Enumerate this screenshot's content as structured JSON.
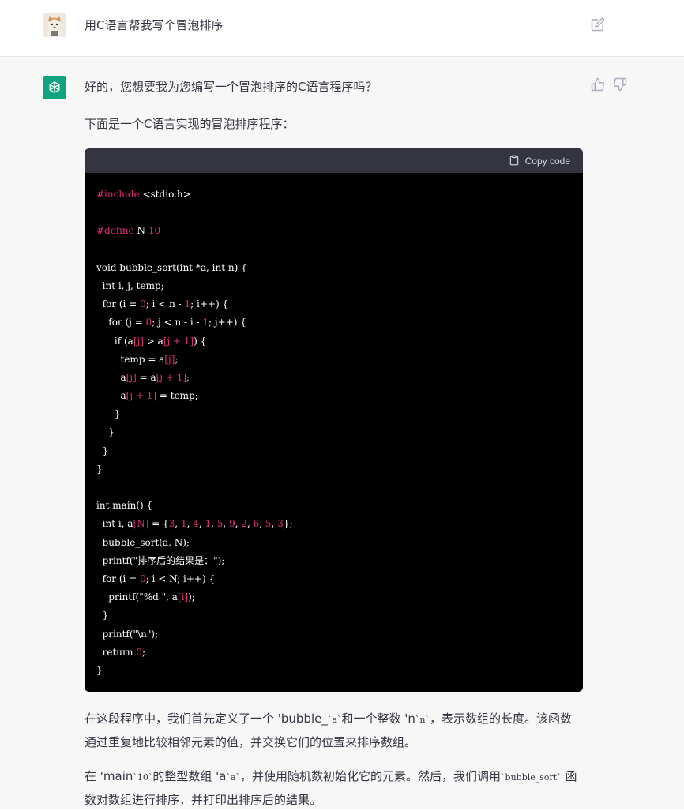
{
  "user": {
    "prompt": "用C语言帮我写个冒泡排序"
  },
  "assistant": {
    "para1": "好的，您想要我为您编写一个冒泡排序的C语言程序吗？",
    "para2": "下面是一个C语言实现的冒泡排序程序：",
    "code": {
      "copy_label": "Copy code",
      "lines": [
        [
          {
            "t": "#include ",
            "c": "red"
          },
          {
            "t": "<stdio.h>",
            "c": ""
          }
        ],
        [],
        [
          {
            "t": "#define ",
            "c": "red"
          },
          {
            "t": "N ",
            "c": ""
          },
          {
            "t": "10",
            "c": "red"
          }
        ],
        [],
        [
          {
            "t": "void bubble_sort(int *a, int n) {",
            "c": ""
          }
        ],
        [
          {
            "t": "  int i, j, temp;",
            "c": ""
          }
        ],
        [
          {
            "t": "  for (i = ",
            "c": ""
          },
          {
            "t": "0",
            "c": "red"
          },
          {
            "t": "; i < n - ",
            "c": ""
          },
          {
            "t": "1",
            "c": "red"
          },
          {
            "t": "; i++) {",
            "c": ""
          }
        ],
        [
          {
            "t": "    for (j = ",
            "c": ""
          },
          {
            "t": "0",
            "c": "red"
          },
          {
            "t": "; j < n - i - ",
            "c": ""
          },
          {
            "t": "1",
            "c": "red"
          },
          {
            "t": "; j++) {",
            "c": ""
          }
        ],
        [
          {
            "t": "      if (a",
            "c": ""
          },
          {
            "t": "[j]",
            "c": "red"
          },
          {
            "t": " > a",
            "c": ""
          },
          {
            "t": "[j + 1]",
            "c": "red"
          },
          {
            "t": ") {",
            "c": ""
          }
        ],
        [
          {
            "t": "        temp = a",
            "c": ""
          },
          {
            "t": "[j]",
            "c": "red"
          },
          {
            "t": ";",
            "c": ""
          }
        ],
        [
          {
            "t": "        a",
            "c": ""
          },
          {
            "t": "[j]",
            "c": "red"
          },
          {
            "t": " = a",
            "c": ""
          },
          {
            "t": "[j + 1]",
            "c": "red"
          },
          {
            "t": ";",
            "c": ""
          }
        ],
        [
          {
            "t": "        a",
            "c": ""
          },
          {
            "t": "[j + 1]",
            "c": "red"
          },
          {
            "t": " = temp;",
            "c": ""
          }
        ],
        [
          {
            "t": "      }",
            "c": ""
          }
        ],
        [
          {
            "t": "    }",
            "c": ""
          }
        ],
        [
          {
            "t": "  }",
            "c": ""
          }
        ],
        [
          {
            "t": "}",
            "c": ""
          }
        ],
        [],
        [
          {
            "t": "int main() {",
            "c": ""
          }
        ],
        [
          {
            "t": "  int i, a",
            "c": ""
          },
          {
            "t": "[N]",
            "c": "red"
          },
          {
            "t": " = {",
            "c": ""
          },
          {
            "t": "3",
            "c": "red"
          },
          {
            "t": ", ",
            "c": ""
          },
          {
            "t": "1",
            "c": "red"
          },
          {
            "t": ", ",
            "c": ""
          },
          {
            "t": "4",
            "c": "red"
          },
          {
            "t": ", ",
            "c": ""
          },
          {
            "t": "1",
            "c": "red"
          },
          {
            "t": ", ",
            "c": ""
          },
          {
            "t": "5",
            "c": "red"
          },
          {
            "t": ", ",
            "c": ""
          },
          {
            "t": "9",
            "c": "red"
          },
          {
            "t": ", ",
            "c": ""
          },
          {
            "t": "2",
            "c": "red"
          },
          {
            "t": ", ",
            "c": ""
          },
          {
            "t": "6",
            "c": "red"
          },
          {
            "t": ", ",
            "c": ""
          },
          {
            "t": "5",
            "c": "red"
          },
          {
            "t": ", ",
            "c": ""
          },
          {
            "t": "3",
            "c": "red"
          },
          {
            "t": "};",
            "c": ""
          }
        ],
        [
          {
            "t": "  bubble_sort(a, N);",
            "c": ""
          }
        ],
        [
          {
            "t": "  printf(\"排序后的结果是：\");",
            "c": ""
          }
        ],
        [
          {
            "t": "  for (i = ",
            "c": ""
          },
          {
            "t": "0",
            "c": "red"
          },
          {
            "t": "; i < N; i++) {",
            "c": ""
          }
        ],
        [
          {
            "t": "    printf(\"%d \", a",
            "c": ""
          },
          {
            "t": "[i]",
            "c": "red"
          },
          {
            "t": ");",
            "c": ""
          }
        ],
        [
          {
            "t": "  }",
            "c": ""
          }
        ],
        [
          {
            "t": "  printf(\"\\n\");",
            "c": ""
          }
        ],
        [
          {
            "t": "  return ",
            "c": ""
          },
          {
            "t": "0",
            "c": "red"
          },
          {
            "t": ";",
            "c": ""
          }
        ],
        [
          {
            "t": "}",
            "c": ""
          }
        ]
      ]
    },
    "para3": [
      {
        "t": "在这段程序中，我们首先定义了一个 'bubble_",
        "code": false
      },
      {
        "t": "`a`",
        "code": true
      },
      {
        "t": "和一个整数 'n",
        "code": false
      },
      {
        "t": "`n`",
        "code": true
      },
      {
        "t": "，表示数组的长度。该函数通过重复地比较相邻元素的值，并交换它们的位置来排序数组。",
        "code": false
      }
    ],
    "para4": [
      {
        "t": "在 'main",
        "code": false
      },
      {
        "t": "`10`",
        "code": true
      },
      {
        "t": "的整型数组 'a",
        "code": false
      },
      {
        "t": "`a`",
        "code": true
      },
      {
        "t": "，并使用随机数初始化它的元素。然后，我们调用",
        "code": false
      },
      {
        "t": "`bubble_sort`",
        "code": true
      },
      {
        "t": " 函数对数组进行排序，并打印出排序后的结果。",
        "code": false
      }
    ]
  },
  "colors": {
    "assistant_bg": "#f7f7f8",
    "code_bg": "#000000",
    "code_header_bg": "#343541",
    "accent": "#10a37f",
    "code_number": "#df3079"
  },
  "icons": [
    "user-avatar",
    "edit-icon",
    "openai-logo-icon",
    "thumbs-up-icon",
    "thumbs-down-icon",
    "clipboard-icon"
  ]
}
